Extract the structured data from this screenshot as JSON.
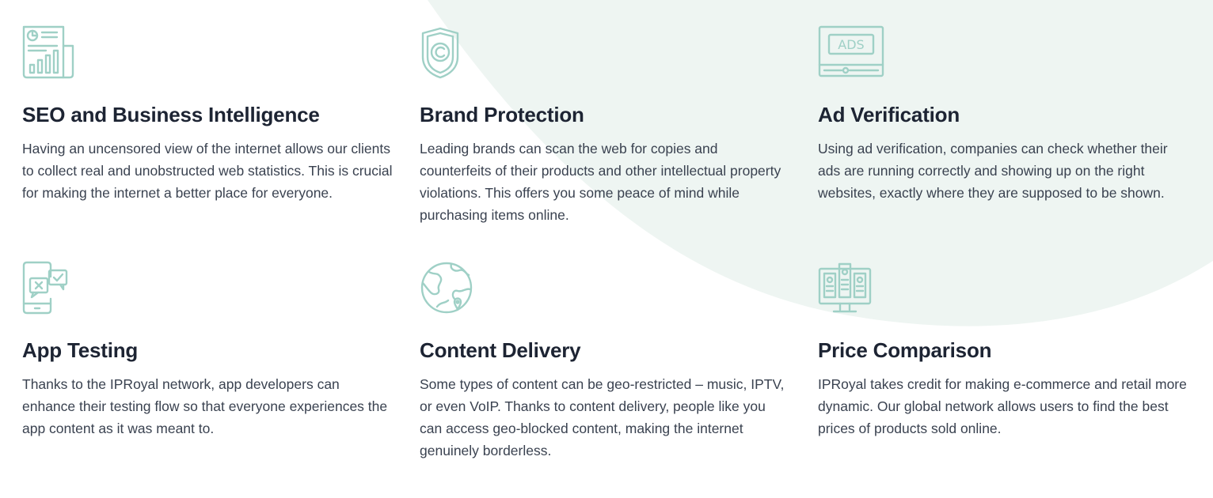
{
  "colors": {
    "accent": "#9fd0c6",
    "background_shape": "#eef5f2",
    "title": "#1d2433",
    "text": "#3a4250"
  },
  "features": [
    {
      "icon": "seo-report-icon",
      "title": "SEO and Business Intelligence",
      "description": "Having an uncensored view of the internet allows our clients to collect real and unobstructed web statistics. This is crucial for making the internet a better place for everyone."
    },
    {
      "icon": "shield-copyright-icon",
      "title": "Brand Protection",
      "description": "Leading brands can scan the web for copies and counterfeits of their products and other intellectual property violations. This offers you some peace of mind while purchasing items online."
    },
    {
      "icon": "ads-screen-icon",
      "title": "Ad Verification",
      "description": "Using ad verification, companies can check whether their ads are running correctly and showing up on the right websites, exactly where they are supposed to be shown."
    },
    {
      "icon": "phone-chat-icon",
      "title": "App Testing",
      "description": "Thanks to the IPRoyal network, app developers can enhance their testing flow so that everyone experiences the app content as it was meant to."
    },
    {
      "icon": "globe-pin-icon",
      "title": "Content Delivery",
      "description": "Some types of content can be geo-restricted – music, IPTV, or even VoIP. Thanks to content delivery, people like you can access geo-blocked content, making the internet genuinely borderless."
    },
    {
      "icon": "monitor-compare-icon",
      "title": "Price Comparison",
      "description": "IPRoyal takes credit for making e-commerce and retail more dynamic. Our global network allows users to find the best prices of products sold online."
    }
  ]
}
